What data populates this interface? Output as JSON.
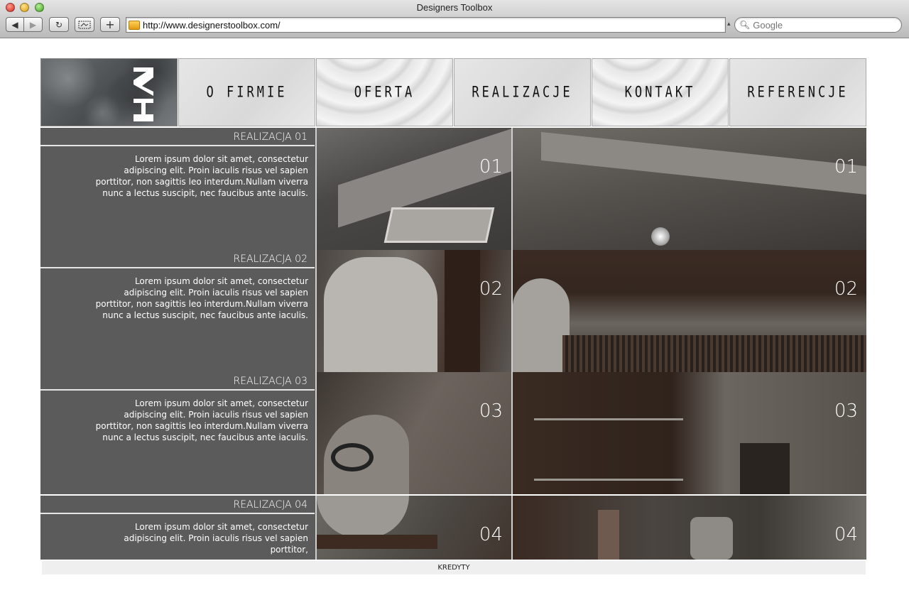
{
  "window": {
    "title": "Designers Toolbox"
  },
  "toolbar": {
    "back_icon": "back-arrow-icon",
    "forward_icon": "forward-arrow-icon",
    "reload_icon": "reload-icon",
    "screenshot_icon": "screenshot-icon",
    "add_icon": "plus-icon"
  },
  "address_bar": {
    "url": "http://www.designerstoolbox.com/"
  },
  "search": {
    "placeholder": "Google"
  },
  "nav": {
    "items": [
      {
        "label": "O FIRMIE"
      },
      {
        "label": "OFERTA"
      },
      {
        "label": "REALIZACJE"
      },
      {
        "label": "KONTAKT"
      },
      {
        "label": "REFERENCJE"
      }
    ]
  },
  "projects": [
    {
      "title": "REALIZACJA 01",
      "description": "Lorem ipsum dolor sit amet, consectetur adipiscing elit. Proin iaculis risus vel sapien porttitor, non sagittis leo interdum.Nullam viverra nunc a lectus suscipit, nec faucibus ante iaculis.",
      "number": "01"
    },
    {
      "title": "REALIZACJA 02",
      "description": "Lorem ipsum dolor sit amet, consectetur adipiscing elit. Proin iaculis risus vel sapien porttitor, non sagittis leo interdum.Nullam viverra nunc a lectus suscipit, nec faucibus ante iaculis.",
      "number": "02"
    },
    {
      "title": "REALIZACJA 03",
      "description": "Lorem ipsum dolor sit amet, consectetur adipiscing elit. Proin iaculis risus vel sapien porttitor, non sagittis leo interdum.Nullam viverra nunc a lectus suscipit, nec faucibus ante iaculis.",
      "number": "03"
    },
    {
      "title": "REALIZACJA 04",
      "description": "Lorem ipsum dolor sit amet, consectetur adipiscing elit. Proin iaculis risus vel sapien porttitor,",
      "number": "04"
    }
  ],
  "footer": {
    "label": "KREDYTY"
  }
}
